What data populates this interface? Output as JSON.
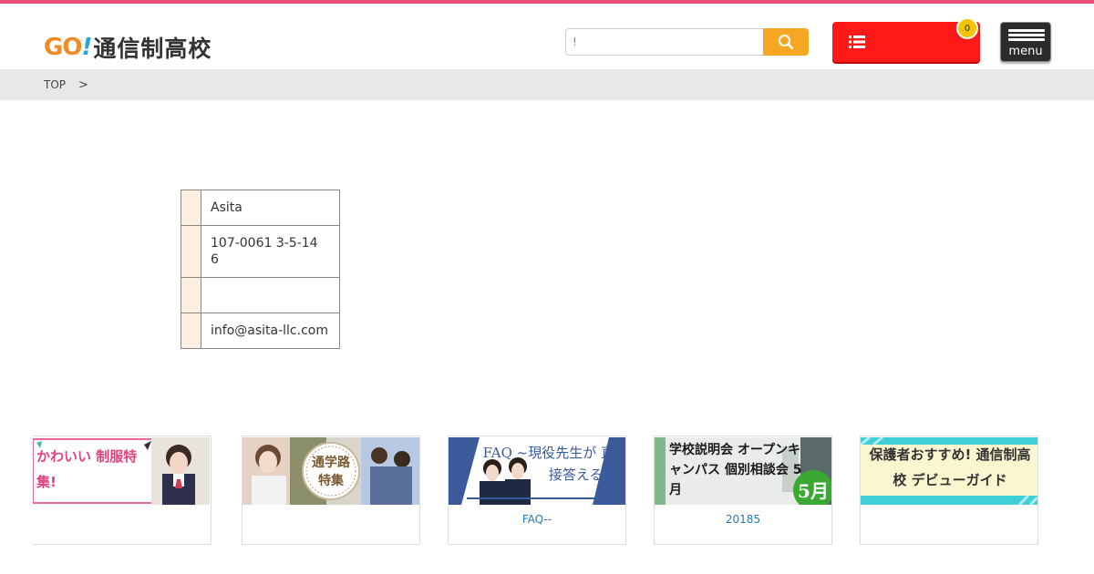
{
  "header": {
    "logo_go": "GO",
    "logo_bang": "!",
    "logo_text": "通信制高校",
    "search": {
      "value": "!",
      "placeholder": ""
    },
    "list_badge": "0",
    "menu_label": "menu"
  },
  "breadcrumb": {
    "top": "TOP",
    "separator": ">"
  },
  "info": {
    "rows": [
      {
        "value": "Asita"
      },
      {
        "value": "107-0061 3-5-14\n6"
      },
      {
        "value": ""
      },
      {
        "value": "info@asita-llc.com"
      }
    ]
  },
  "banners": [
    {
      "image_text": "かわいい 制服特集!",
      "caption": ""
    },
    {
      "image_text": "通学路 特集",
      "caption": ""
    },
    {
      "image_text": "FAQ ~現役先生が 直接答える~",
      "caption": "FAQ--"
    },
    {
      "image_text": "学校説明会 オープンキャンパス 個別相談会 5月",
      "caption": "20185"
    },
    {
      "image_text": "保護者おすすめ! 通信制高校 デビューガイド",
      "caption": ""
    }
  ],
  "colors": {
    "accent_stripe": "#ef4f7c",
    "search_button": "#f5a623",
    "list_button": "#ff1a1a",
    "badge": "#f3c400",
    "table_header": "#fdf0e0"
  },
  "icons": [
    "search-icon",
    "list-icon",
    "hamburger-icon"
  ]
}
